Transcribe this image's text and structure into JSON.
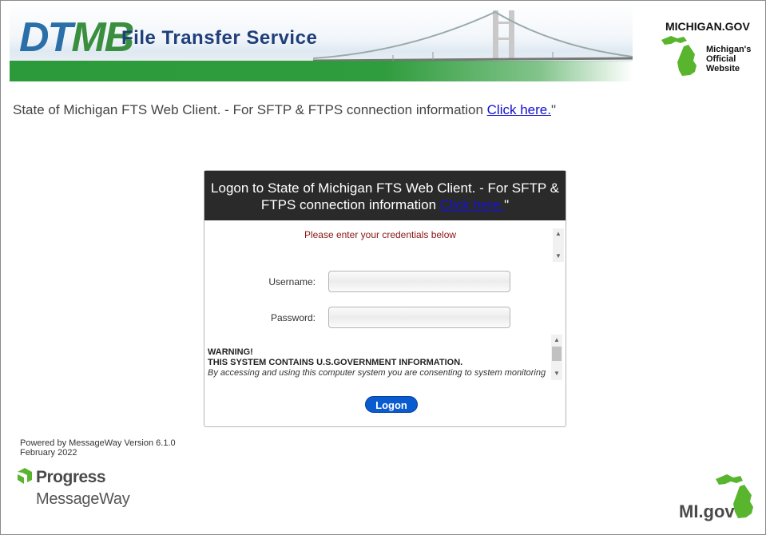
{
  "header": {
    "logo_text_a": "DT",
    "logo_text_b": "MB",
    "title": "File Transfer Service",
    "michigan_gov": "MICHIGAN.GOV",
    "official_line1": "Michigan's",
    "official_line2": "Official",
    "official_line3": "Website"
  },
  "intro": {
    "text": "State of Michigan FTS Web Client. - For SFTP & FTPS connection information ",
    "link": "Click here.",
    "suffix": "\""
  },
  "logon": {
    "heading": "Logon to State of Michigan FTS Web Client. - For SFTP & FTPS connection information ",
    "heading_link": "Click here.",
    "heading_suffix": "\"",
    "credentials_msg": "Please enter your credentials below",
    "username_label": "Username:",
    "password_label": "Password:",
    "username_value": "",
    "password_value": "",
    "warning_title": "WARNING!",
    "warning_line": "THIS SYSTEM CONTAINS U.S.GOVERNMENT INFORMATION.",
    "warning_body": "By accessing and using this computer system you are consenting to system monitoring for law enforcement and other purposes.",
    "button": "Logon"
  },
  "footer": {
    "powered": "Powered by MessageWay Version 6.1.0",
    "date": "February 2022",
    "progress": "Progress",
    "messageway": "MessageWay",
    "mi_gov": "MI.gov"
  },
  "colors": {
    "brand_green": "#2f9c3d",
    "brand_blue": "#1f3f7a",
    "button_blue": "#0a5ad0",
    "header_dark": "#2a2a2a"
  }
}
